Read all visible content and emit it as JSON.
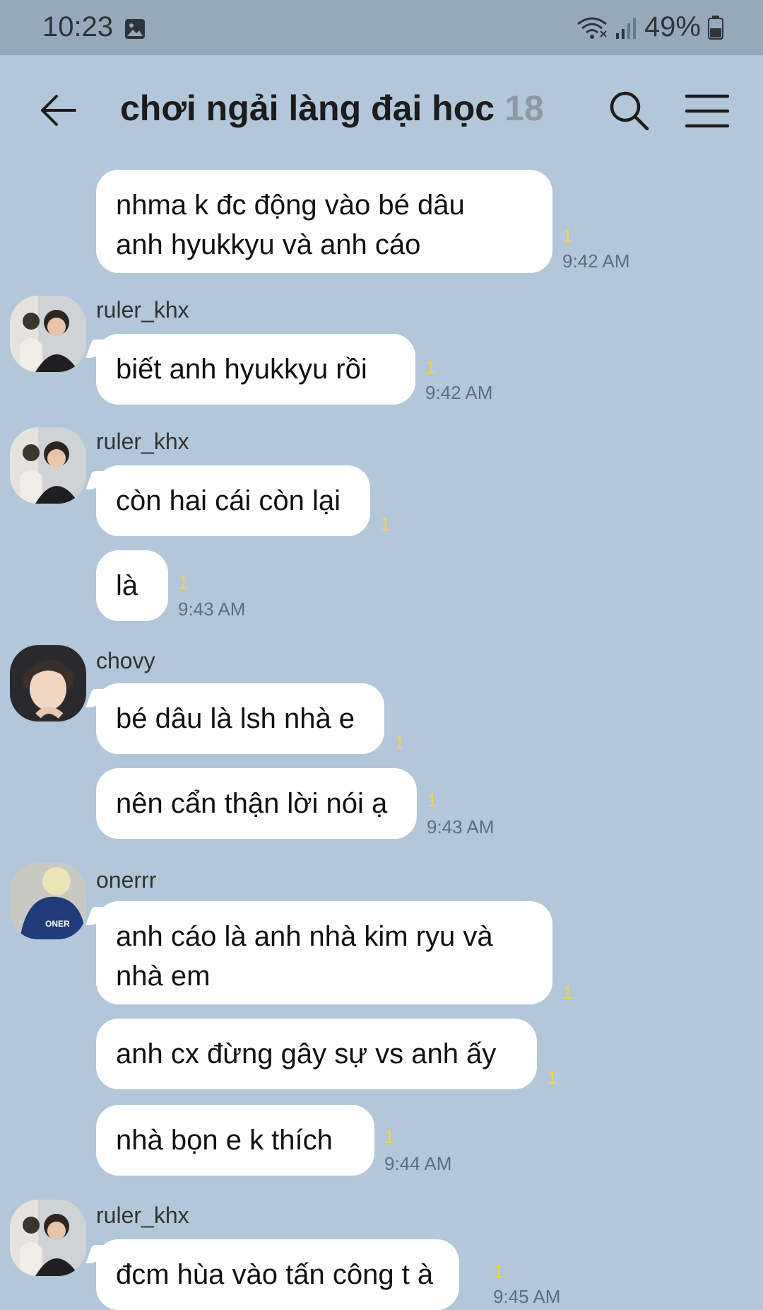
{
  "status": {
    "time": "10:23",
    "battery": "49%"
  },
  "header": {
    "title": "chơi ngải làng đại học",
    "count": "18"
  },
  "messages": [
    {
      "sender": "",
      "lines": [
        "nhma k đc động vào bé dâu",
        "anh hyukkyu và anh cáo"
      ],
      "unread": "1",
      "time": "9:42 AM"
    },
    {
      "sender": "ruler_khx",
      "lines": [
        "biết anh hyukkyu rồi"
      ],
      "unread": "1",
      "time": "9:42 AM"
    },
    {
      "sender": "ruler_khx",
      "lines": [
        "còn hai cái còn lại"
      ],
      "unread": "1",
      "time": ""
    },
    {
      "sender": "",
      "lines": [
        "là"
      ],
      "unread": "1",
      "time": "9:43 AM"
    },
    {
      "sender": "chovy",
      "lines": [
        "bé dâu là lsh nhà e"
      ],
      "unread": "1",
      "time": ""
    },
    {
      "sender": "",
      "lines": [
        "nên cẩn thận lời nói ạ"
      ],
      "unread": "1",
      "time": "9:43 AM"
    },
    {
      "sender": "onerrr",
      "lines": [
        "anh cáo là anh nhà kim ryu và",
        "nhà em"
      ],
      "unread": "1",
      "time": ""
    },
    {
      "sender": "",
      "lines": [
        "anh cx đừng gây sự vs anh ấy"
      ],
      "unread": "1",
      "time": ""
    },
    {
      "sender": "",
      "lines": [
        "nhà bọn e k thích"
      ],
      "unread": "1",
      "time": "9:44 AM"
    },
    {
      "sender": "ruler_khx",
      "lines": [
        "đcm hùa vào tấn công t à"
      ],
      "unread": "1",
      "time": "9:45 AM"
    }
  ],
  "icons": {
    "back": "back-arrow-icon",
    "search": "search-icon",
    "menu": "menu-icon"
  },
  "colors": {
    "background": "#b2c7d9",
    "statusbar": "#95a9bb",
    "bubble": "#ffffff",
    "unread": "#f1d54a"
  }
}
